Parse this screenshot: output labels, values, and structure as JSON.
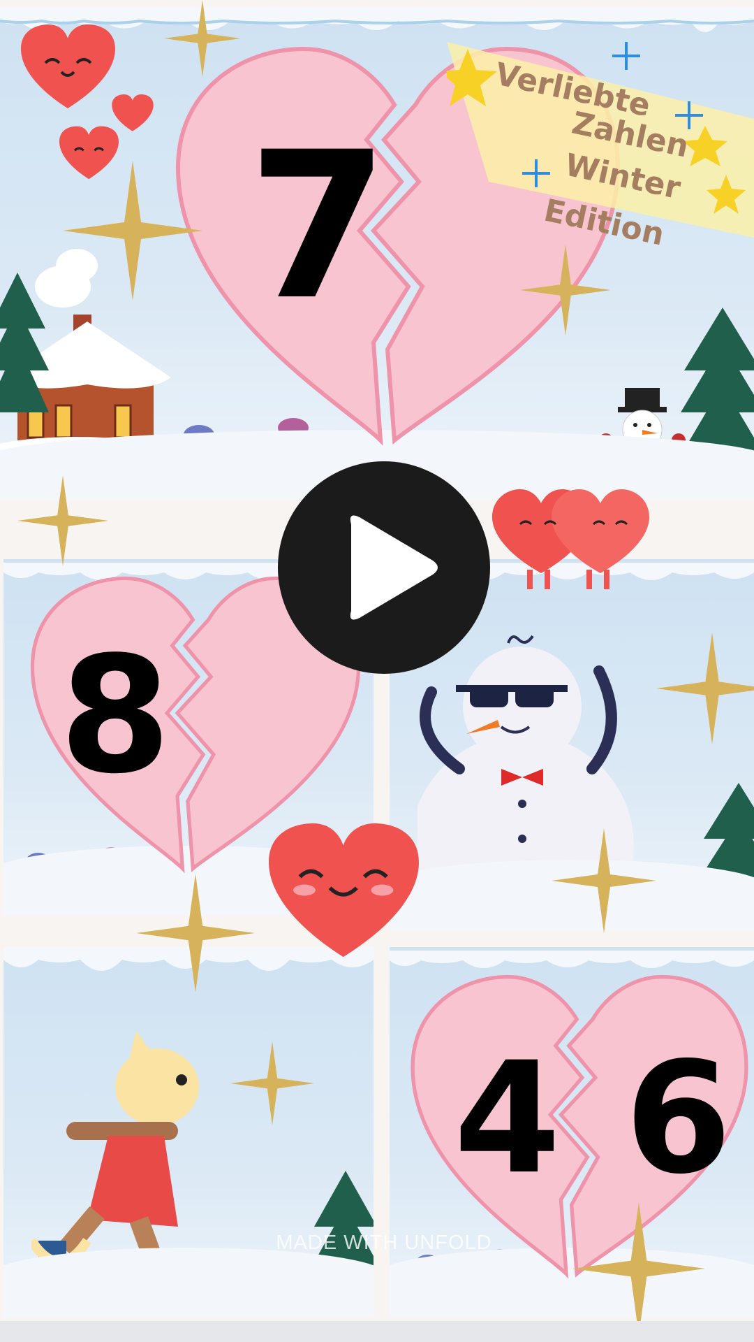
{
  "title": {
    "line1": "Verliebte",
    "line2": "Zahlen",
    "line3": "Winter",
    "line4": "Edition"
  },
  "cards": {
    "top_number": "7",
    "middle_left_number": "8",
    "bottom_right_left_number": "4",
    "bottom_right_right_number": "6"
  },
  "watermark": "MADE WITH UNFOLD",
  "colors": {
    "heart_pink": "#f8c4d0",
    "heart_outline": "#ee93a9",
    "red_heart": "#f0524f",
    "play_button": "#1b1b1b",
    "sky": "#cfe2f2",
    "gold_sparkle": "#d6b35a"
  },
  "icons": {
    "play": "play-icon",
    "hearts": "smiling-heart-icon",
    "snowflake": "snowflake-icon",
    "star": "star-icon"
  }
}
